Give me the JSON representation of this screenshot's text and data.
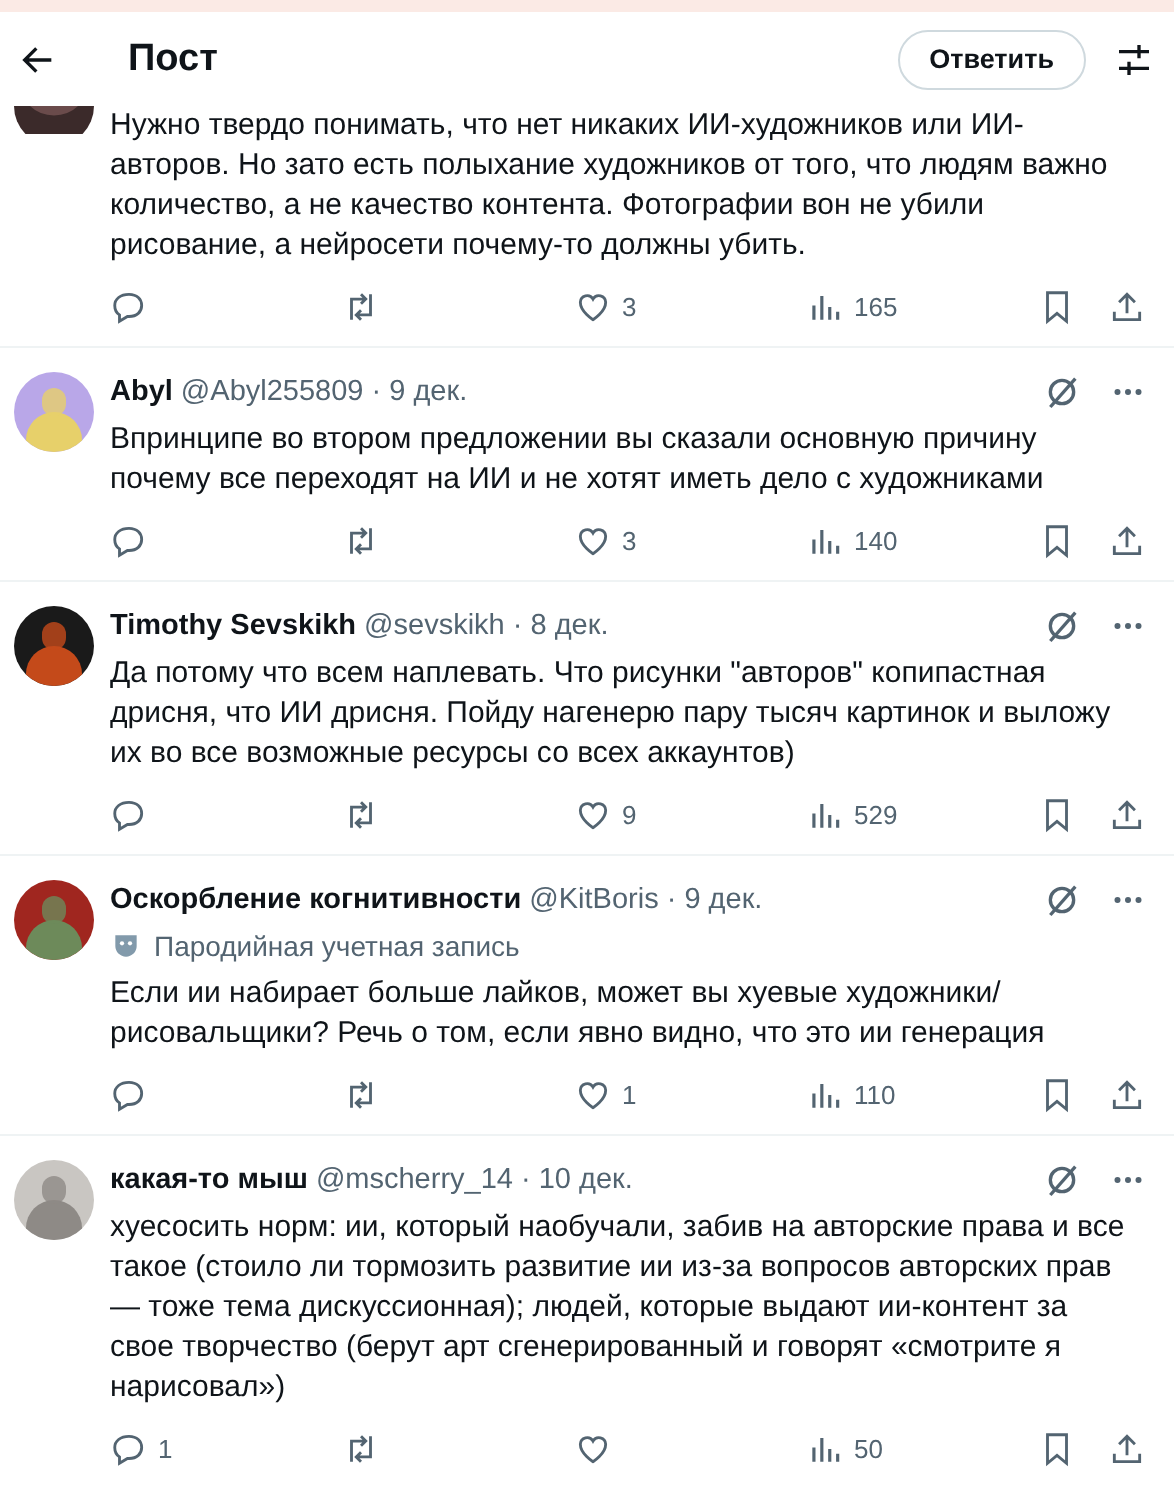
{
  "header": {
    "title": "Пост",
    "reply_button": "Ответить"
  },
  "posts": [
    {
      "text": "Нужно твердо понимать, что нет никаких ИИ-художников или ИИ-авторов. Но зато есть полыхание художников от того, что людям важно количество, а не качество контента. Фотографии вон не убили рисование, а нейросети почему-то должны убить.",
      "likes": "3",
      "views": "165"
    },
    {
      "author": "Abyl",
      "meta": "@Abyl255809 · 9 дек.",
      "text": "Впринципе во втором предложении вы сказали основную причину почему все переходят на ИИ и не хотят иметь дело с художниками",
      "likes": "3",
      "views": "140"
    },
    {
      "author": "Timothy Sevskikh",
      "meta": "@sevskikh · 8 дек.",
      "text": "Да потому что всем наплевать. Что рисунки \"авторов\" копипастная дрисня, что ИИ дрисня. Пойду нагенерю пару тысяч картинок и выложу их во все возможные ресурсы со всех аккаунтов)",
      "likes": "9",
      "views": "529"
    },
    {
      "author": "Оскорбление когнитивности",
      "meta": "@KitBoris · 9 дек.",
      "label": "Пародийная учетная запись",
      "text": "Если ии набирает больше лайков, может вы хуевые художники/ рисовальщики? Речь о том, если явно видно, что это ии генерация",
      "likes": "1",
      "views": "110"
    },
    {
      "author": "какая-то мыш",
      "meta": "@mscherry_14 · 10 дек.",
      "text": "хуесосить норм: ии, который наобучали, забив на авторские права и все такое (стоило ли тормозить развитие ии из-за вопросов авторских прав — тоже тема дискуссионная); людей, которые выдают ии-контент за свое творчество (берут арт сгенерированный и говорят «смотрите я нарисовал»)",
      "replies": "1",
      "views": "50"
    }
  ]
}
